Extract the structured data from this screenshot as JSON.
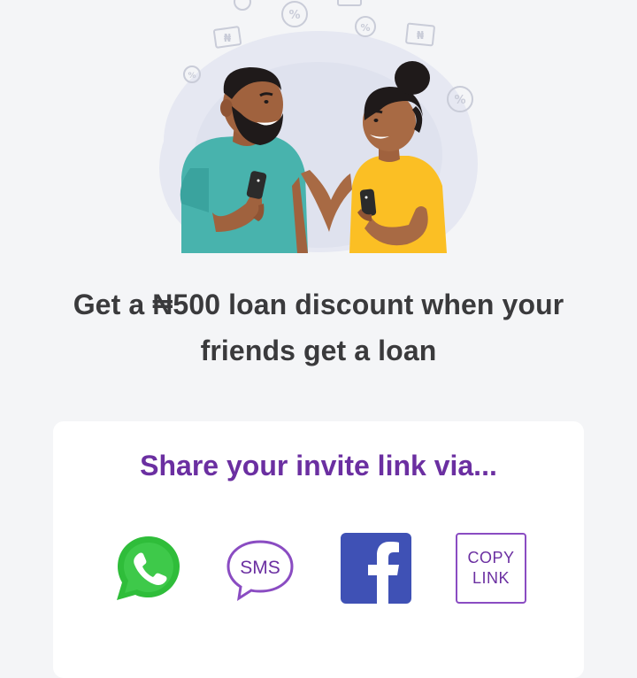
{
  "promo": {
    "headline_line1": "Get a ₦500 loan discount when your",
    "headline_line2": "friends get a loan"
  },
  "share": {
    "title": "Share your invite link via...",
    "options": [
      {
        "name": "whatsapp",
        "icon": "whatsapp-icon"
      },
      {
        "name": "sms",
        "icon": "sms-icon",
        "label": "SMS"
      },
      {
        "name": "facebook",
        "icon": "facebook-icon"
      },
      {
        "name": "copy-link",
        "line1": "COPY",
        "line2": "LINK"
      }
    ]
  },
  "colors": {
    "background": "#f4f5f7",
    "brand_purple": "#6b2fa1",
    "whatsapp_green": "#2fbd3a",
    "facebook_blue": "#3f51b5",
    "headline_text": "#3a3a3c"
  },
  "illustration": {
    "currency_symbol": "₦",
    "percent_symbol": "%"
  }
}
